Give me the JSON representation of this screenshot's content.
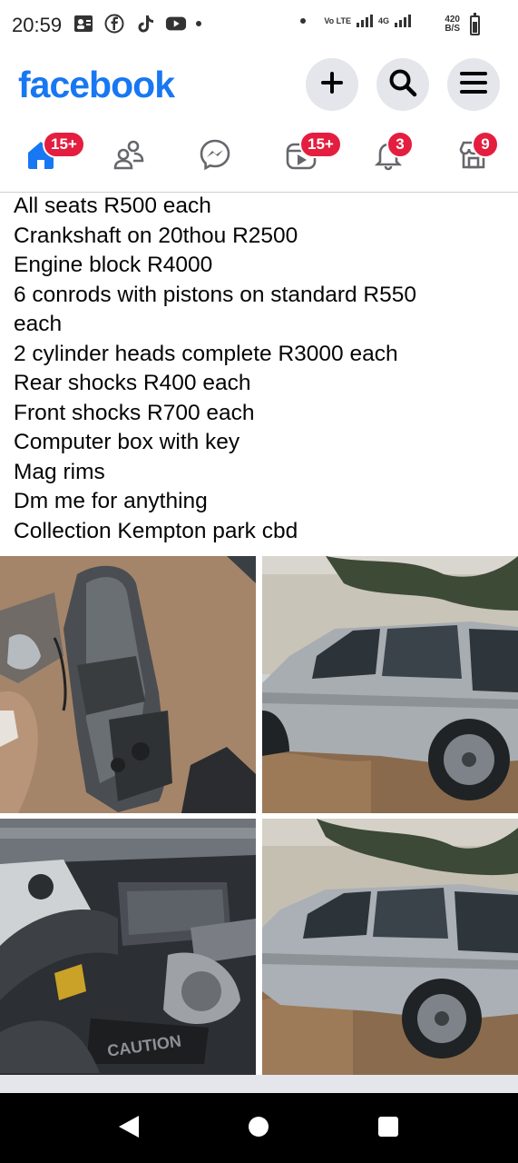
{
  "status_bar": {
    "time": "20:59",
    "network_1": "Vo LTE",
    "network_2": "4G",
    "speed": "420",
    "speed_unit": "B/S"
  },
  "header": {
    "logo": "facebook",
    "create_icon": "plus-icon",
    "search_icon": "search-icon",
    "menu_icon": "menu-icon",
    "brand_color": "#1877f2"
  },
  "nav": {
    "tabs": [
      {
        "name": "home",
        "icon": "home-icon",
        "badge": "15+"
      },
      {
        "name": "friends",
        "icon": "friends-icon",
        "badge": ""
      },
      {
        "name": "messenger",
        "icon": "messenger-icon",
        "badge": ""
      },
      {
        "name": "video",
        "icon": "video-icon",
        "badge": "15+"
      },
      {
        "name": "notifications",
        "icon": "bell-icon",
        "badge": "3"
      },
      {
        "name": "marketplace",
        "icon": "marketplace-icon",
        "badge": "9"
      }
    ],
    "badge_color": "#e41e3f"
  },
  "post": {
    "lines": [
      "All seats R500 each",
      "Crankshaft on 20thou R2500",
      "Engine block R4000",
      "6 conrods with pistons on standard R550",
      "each",
      "2 cylinder heads complete R3000 each",
      "Rear shocks R400 each",
      "Front shocks R700 each",
      "Computer box with key",
      "Mag rims",
      "Dm me for anything",
      "Collection Kempton park cbd"
    ],
    "photos": [
      {
        "subject": "gearbox-on-ground"
      },
      {
        "subject": "silver-suv-side"
      },
      {
        "subject": "engine-bay"
      },
      {
        "subject": "silver-suv-side-2"
      }
    ],
    "engine_cover_text": "CAUTION"
  },
  "android_nav": {
    "back_icon": "back-icon",
    "home_icon": "home-circle-icon",
    "recents_icon": "recents-icon"
  }
}
